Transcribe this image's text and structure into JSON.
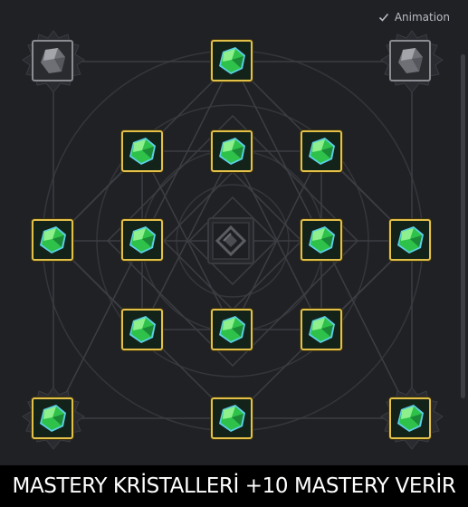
{
  "animation_toggle": {
    "label": "Animation",
    "checked": true
  },
  "caption": "MASTERY KRİSTALLERİ +10 MASTERY VERİR",
  "colors": {
    "background": "#202125",
    "slot_border_active": "#e3c04a",
    "slot_border_locked": "#8a8c91",
    "crystal_green": "#2ec24a",
    "crystal_edge": "#5ad0e6",
    "caption_bg": "#000000",
    "caption_text": "#ffffff"
  },
  "slots": [
    {
      "id": "top-left",
      "state": "locked",
      "item": "grey-stone"
    },
    {
      "id": "top-center",
      "state": "active",
      "item": "green-crystal"
    },
    {
      "id": "top-right",
      "state": "locked",
      "item": "grey-stone"
    },
    {
      "id": "row2-left",
      "state": "active",
      "item": "green-crystal"
    },
    {
      "id": "row2-center",
      "state": "active",
      "item": "green-crystal"
    },
    {
      "id": "row2-right",
      "state": "active",
      "item": "green-crystal"
    },
    {
      "id": "mid-far-left",
      "state": "active",
      "item": "green-crystal"
    },
    {
      "id": "mid-left",
      "state": "active",
      "item": "green-crystal"
    },
    {
      "id": "mid-right",
      "state": "active",
      "item": "green-crystal"
    },
    {
      "id": "mid-far-right",
      "state": "active",
      "item": "green-crystal"
    },
    {
      "id": "row4-left",
      "state": "active",
      "item": "green-crystal"
    },
    {
      "id": "row4-center",
      "state": "active",
      "item": "green-crystal"
    },
    {
      "id": "row4-right",
      "state": "active",
      "item": "green-crystal"
    },
    {
      "id": "bottom-left",
      "state": "active",
      "item": "green-crystal"
    },
    {
      "id": "bottom-center",
      "state": "active",
      "item": "green-crystal"
    },
    {
      "id": "bottom-right",
      "state": "active",
      "item": "green-crystal"
    }
  ],
  "center_emblem": {
    "icon": "mastery-emblem-icon"
  }
}
